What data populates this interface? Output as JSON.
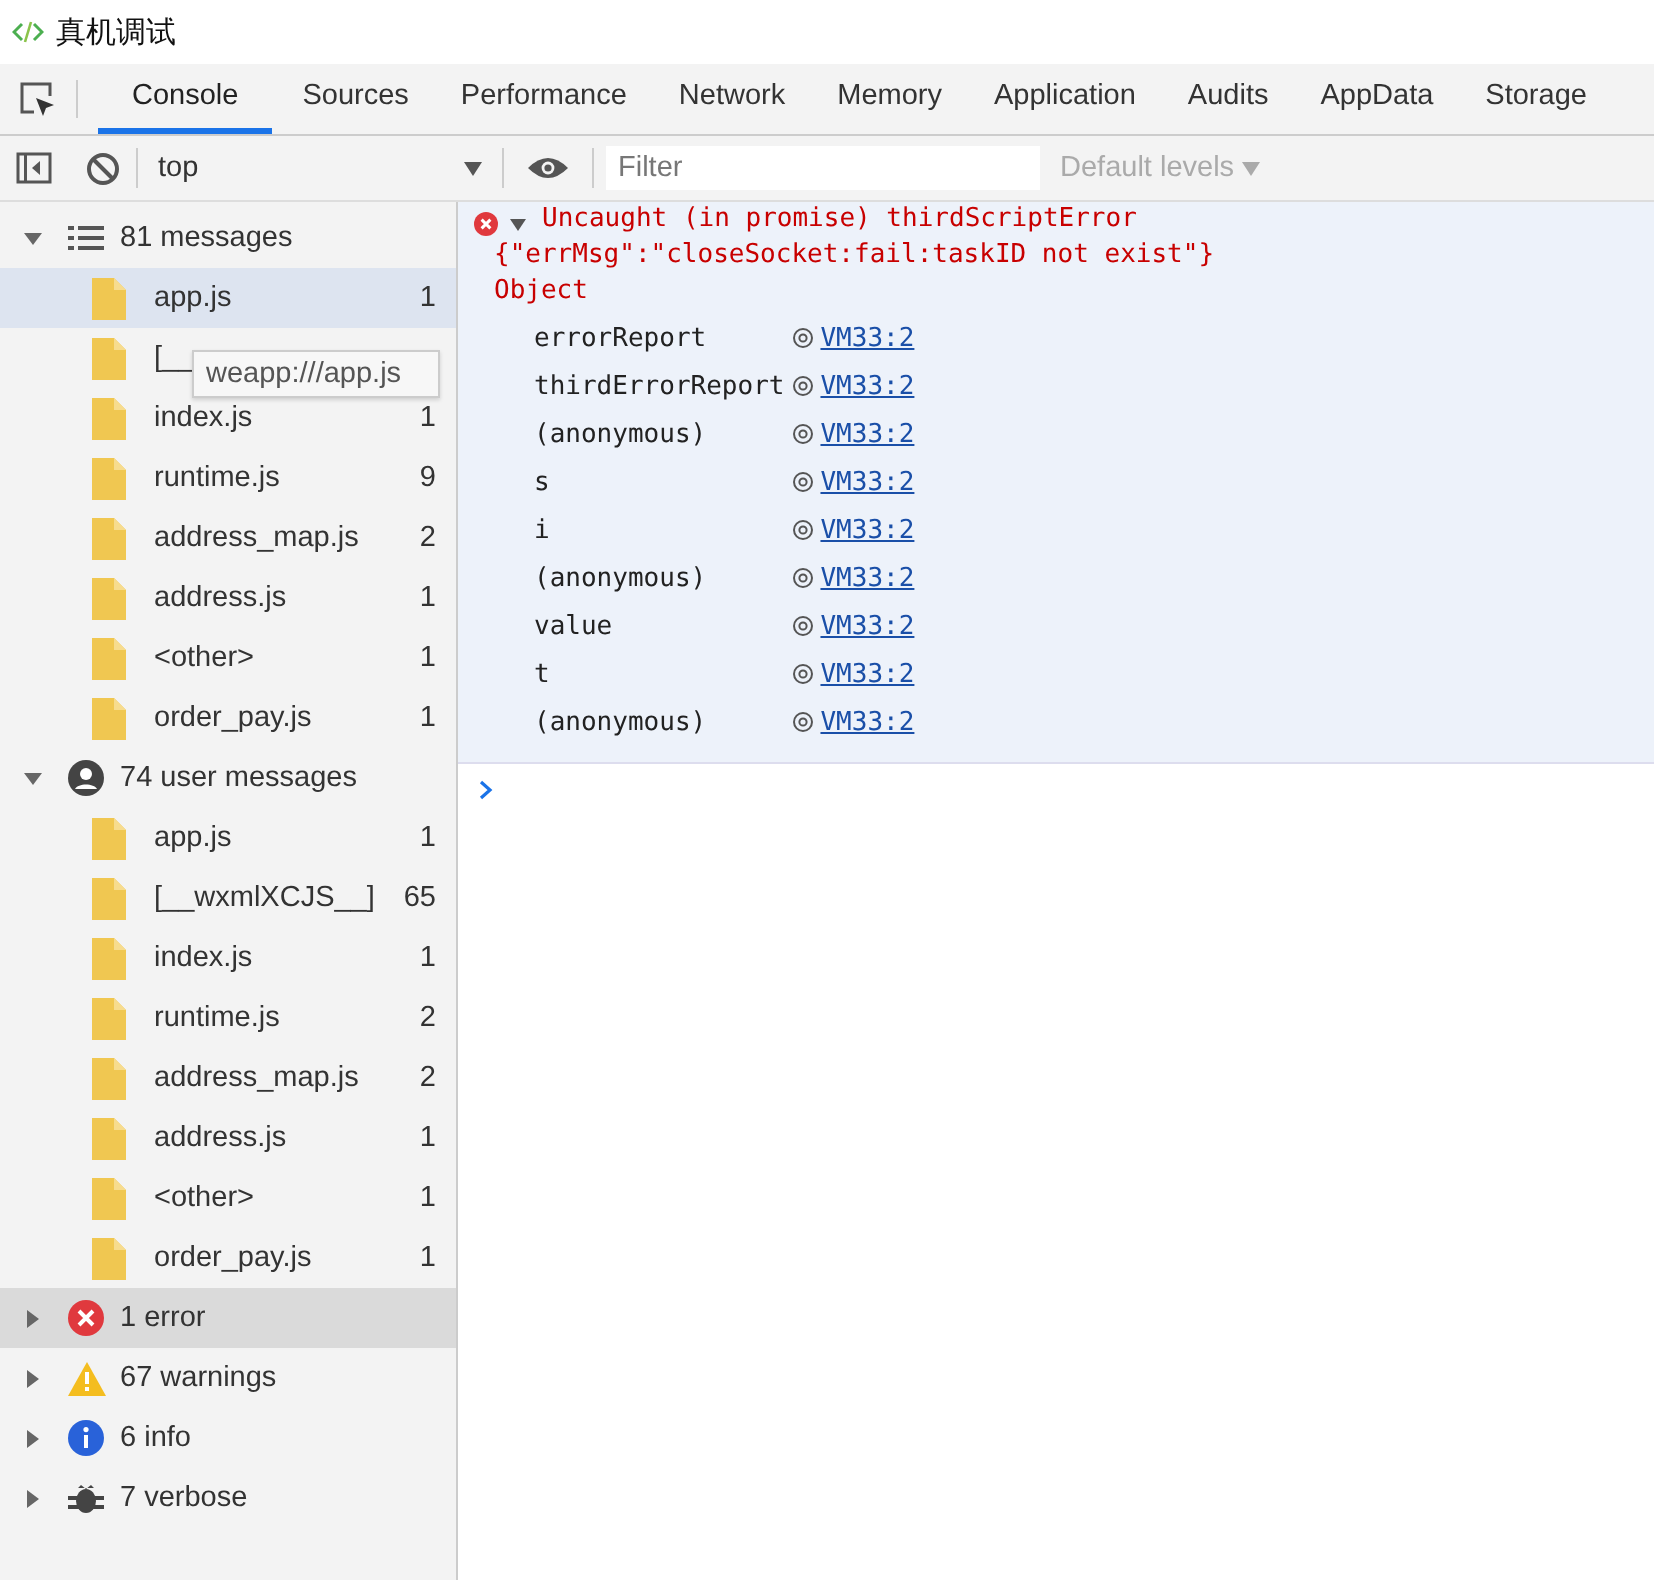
{
  "window": {
    "title": "真机调试"
  },
  "tabs": [
    {
      "label": "Console",
      "selected": true
    },
    {
      "label": "Sources",
      "selected": false
    },
    {
      "label": "Performance",
      "selected": false
    },
    {
      "label": "Network",
      "selected": false
    },
    {
      "label": "Memory",
      "selected": false
    },
    {
      "label": "Application",
      "selected": false
    },
    {
      "label": "Audits",
      "selected": false
    },
    {
      "label": "AppData",
      "selected": false
    },
    {
      "label": "Storage",
      "selected": false
    }
  ],
  "toolbar": {
    "context": "top",
    "filter": {
      "placeholder": "Filter"
    },
    "levels": "Default levels"
  },
  "sidebar": {
    "groups": [
      {
        "kind": "all",
        "label": "81 messages",
        "expanded": true,
        "selected": false,
        "children": [
          {
            "name": "app.js",
            "count": "1",
            "selected": true
          },
          {
            "name": "[__",
            "selected": false
          },
          {
            "name": "index.js",
            "count": "1",
            "selected": false
          },
          {
            "name": "runtime.js",
            "count": "9",
            "selected": false
          },
          {
            "name": "address_map.js",
            "count": "2",
            "selected": false
          },
          {
            "name": "address.js",
            "count": "1",
            "selected": false
          },
          {
            "name": "<other>",
            "count": "1",
            "selected": false
          },
          {
            "name": "order_pay.js",
            "count": "1",
            "selected": false
          }
        ]
      },
      {
        "kind": "user",
        "label": "74 user messages",
        "expanded": true,
        "selected": false,
        "children": [
          {
            "name": "app.js",
            "count": "1",
            "selected": false
          },
          {
            "name": "[__wxmlXCJS__]",
            "count": "65",
            "selected": false
          },
          {
            "name": "index.js",
            "count": "1",
            "selected": false
          },
          {
            "name": "runtime.js",
            "count": "2",
            "selected": false
          },
          {
            "name": "address_map.js",
            "count": "2",
            "selected": false
          },
          {
            "name": "address.js",
            "count": "1",
            "selected": false
          },
          {
            "name": "<other>",
            "count": "1",
            "selected": false
          },
          {
            "name": "order_pay.js",
            "count": "1",
            "selected": false
          }
        ]
      },
      {
        "kind": "error",
        "label": "1 error",
        "expanded": false,
        "selected": true
      },
      {
        "kind": "warning",
        "label": "67 warnings",
        "expanded": false,
        "selected": false
      },
      {
        "kind": "info",
        "label": "6 info",
        "expanded": false,
        "selected": false
      },
      {
        "kind": "verbose",
        "label": "7 verbose",
        "expanded": false,
        "selected": false
      }
    ],
    "tooltip": "weapp:///app.js"
  },
  "console": {
    "message": {
      "kind": "error",
      "expanded": true,
      "lines": [
        "Uncaught (in promise) thirdScriptError",
        "{\"errMsg\":\"closeSocket:fail:taskID not exist\"}",
        "Object"
      ],
      "stack": [
        {
          "function": "errorReport",
          "link": "VM33:2"
        },
        {
          "function": "thirdErrorReport",
          "link": "VM33:2"
        },
        {
          "function": "(anonymous)",
          "link": "VM33:2"
        },
        {
          "function": "s",
          "link": "VM33:2"
        },
        {
          "function": "i",
          "link": "VM33:2"
        },
        {
          "function": "(anonymous)",
          "link": "VM33:2"
        },
        {
          "function": "value",
          "link": "VM33:2"
        },
        {
          "function": "t",
          "link": "VM33:2"
        },
        {
          "function": "(anonymous)",
          "link": "VM33:2"
        }
      ]
    }
  }
}
